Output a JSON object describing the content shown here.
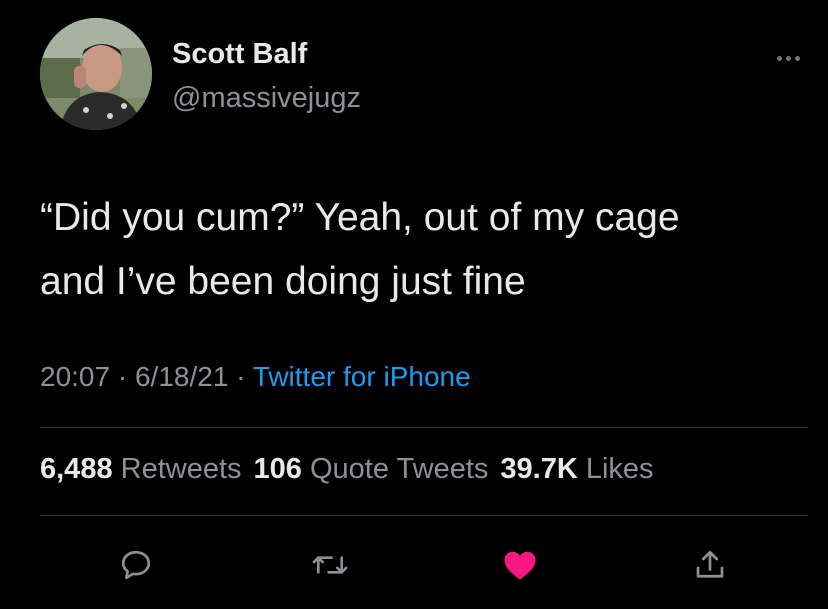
{
  "author": {
    "display_name": "Scott Balf",
    "handle": "@massivejugz"
  },
  "tweet": {
    "lines": [
      "“Did you cum?” Yeah, out of my cage",
      "and I’ve been doing just fine"
    ]
  },
  "meta": {
    "time": "20:07",
    "separator": " · ",
    "date": "6/18/21",
    "source": "Twitter for iPhone"
  },
  "stats": {
    "retweets_count": "6,488",
    "retweets_label": "Retweets",
    "quotes_count": "106",
    "quotes_label": "Quote Tweets",
    "likes_count": "39.7K",
    "likes_label": "Likes"
  },
  "actions": {
    "reply_icon": "reply-icon",
    "retweet_icon": "retweet-icon",
    "like_icon": "heart-icon",
    "share_icon": "share-icon",
    "liked": true
  },
  "colors": {
    "background": "#000000",
    "primary_text": "#e7e9ea",
    "secondary_text": "#8b9197",
    "link": "#1d9bf0",
    "like": "#f91880",
    "divider": "#2f3336"
  }
}
